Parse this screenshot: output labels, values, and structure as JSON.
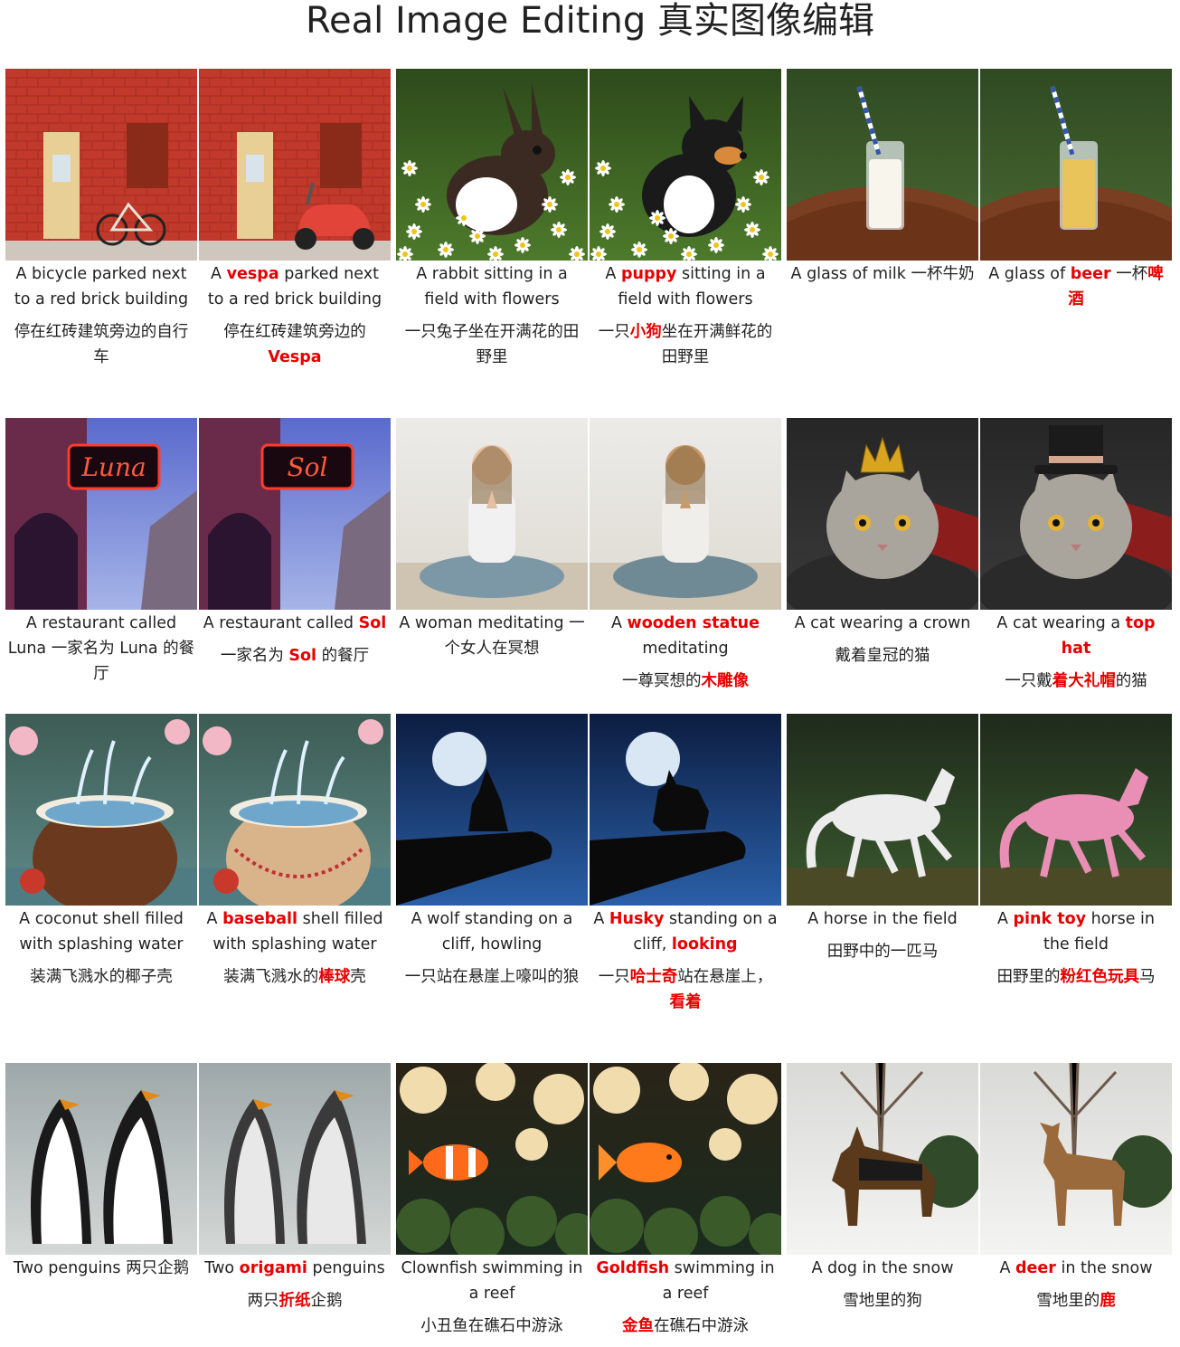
{
  "page": {
    "title": "Real Image Editing 真实图像编辑"
  },
  "colors": {
    "highlight": "#e60000",
    "text": "#222222"
  },
  "rows": [
    {
      "cells": [
        {
          "image": "bicycle-red-brick-wall",
          "en": [
            {
              "t": "A bicycle parked next to a red brick building"
            }
          ],
          "zh": [
            {
              "t": "停在红砖建筑旁边的自行车"
            }
          ]
        },
        {
          "image": "vespa-red-brick-wall",
          "en": [
            {
              "t": "A "
            },
            {
              "t": "vespa",
              "h": true
            },
            {
              "t": " parked next to a red brick building"
            }
          ],
          "zh": [
            {
              "t": "停在红砖建筑旁边的"
            },
            {
              "t": "Vespa",
              "h": true
            }
          ]
        },
        {
          "image": "rabbit-in-daisy-field",
          "en": [
            {
              "t": "A rabbit sitting in a field with flowers"
            }
          ],
          "zh": [
            {
              "t": "一只兔子坐在开满花的田野里"
            }
          ]
        },
        {
          "image": "puppy-in-daisy-field",
          "en": [
            {
              "t": "A "
            },
            {
              "t": "puppy",
              "h": true
            },
            {
              "t": " sitting in a field with flowers"
            }
          ],
          "zh": [
            {
              "t": "一只"
            },
            {
              "t": "小狗",
              "h": true
            },
            {
              "t": "坐在开满鲜花的田野里"
            }
          ]
        },
        {
          "image": "glass-of-milk",
          "en": [
            {
              "t": "A glass of milk 一杯牛奶"
            }
          ],
          "zh": []
        },
        {
          "image": "glass-of-beer",
          "en": [
            {
              "t": "A glass of "
            },
            {
              "t": "beer",
              "h": true
            },
            {
              "t": " 一杯"
            },
            {
              "t": "啤酒",
              "h": true
            }
          ],
          "zh": []
        }
      ]
    },
    {
      "cells": [
        {
          "image": "neon-sign-luna",
          "en": [
            {
              "t": "A restaurant called Luna 一家名为 Luna 的餐厅"
            }
          ],
          "zh": []
        },
        {
          "image": "neon-sign-sol",
          "en": [
            {
              "t": "A restaurant called "
            },
            {
              "t": "Sol",
              "h": true
            }
          ],
          "zh": [
            {
              "t": "一家名为 "
            },
            {
              "t": "Sol",
              "h": true
            },
            {
              "t": " 的餐厅"
            }
          ]
        },
        {
          "image": "woman-meditating",
          "en": [
            {
              "t": "A woman meditating 一个女人在冥想"
            }
          ],
          "zh": []
        },
        {
          "image": "wooden-statue-meditating",
          "en": [
            {
              "t": "A "
            },
            {
              "t": "wooden statue",
              "h": true
            },
            {
              "t": " meditating"
            }
          ],
          "zh": [
            {
              "t": "一尊冥想的"
            },
            {
              "t": "木雕像",
              "h": true
            }
          ]
        },
        {
          "image": "cat-with-crown",
          "en": [
            {
              "t": "A cat wearing a crown"
            }
          ],
          "zh": [
            {
              "t": "戴着皇冠的猫"
            }
          ]
        },
        {
          "image": "cat-with-top-hat",
          "en": [
            {
              "t": "A cat wearing a "
            },
            {
              "t": "top hat",
              "h": true
            }
          ],
          "zh": [
            {
              "t": "一只戴"
            },
            {
              "t": "着大礼帽",
              "h": true
            },
            {
              "t": "的猫"
            }
          ]
        }
      ]
    },
    {
      "cells": [
        {
          "image": "coconut-splash",
          "en": [
            {
              "t": "A coconut shell filled with splashing water"
            }
          ],
          "zh": [
            {
              "t": "装满飞溅水的椰子壳"
            }
          ]
        },
        {
          "image": "baseball-splash",
          "en": [
            {
              "t": "A "
            },
            {
              "t": "baseball",
              "h": true
            },
            {
              "t": " shell filled with splashing water"
            }
          ],
          "zh": [
            {
              "t": "装满飞溅水的"
            },
            {
              "t": "棒球",
              "h": true
            },
            {
              "t": "壳"
            }
          ]
        },
        {
          "image": "wolf-howling-moon",
          "en": [
            {
              "t": "A wolf standing on a cliff, howling"
            }
          ],
          "zh": [
            {
              "t": "一只站在悬崖上嚎叫的狼"
            }
          ]
        },
        {
          "image": "husky-on-cliff",
          "en": [
            {
              "t": "A "
            },
            {
              "t": "Husky",
              "h": true
            },
            {
              "t": " standing on a cliff, "
            },
            {
              "t": "looking",
              "h": true
            }
          ],
          "zh": [
            {
              "t": "一只"
            },
            {
              "t": "哈士奇",
              "h": true
            },
            {
              "t": "站在悬崖上，"
            },
            {
              "t": "看着",
              "h": true
            }
          ]
        },
        {
          "image": "white-horse-running",
          "en": [
            {
              "t": "A horse in the field"
            }
          ],
          "zh": [
            {
              "t": "田野中的一匹马"
            }
          ]
        },
        {
          "image": "pink-toy-horse",
          "en": [
            {
              "t": "A "
            },
            {
              "t": "pink toy",
              "h": true
            },
            {
              "t": " horse in the field"
            }
          ],
          "zh": [
            {
              "t": "田野里的"
            },
            {
              "t": "粉红色玩具",
              "h": true
            },
            {
              "t": "马"
            }
          ]
        }
      ]
    },
    {
      "cells": [
        {
          "image": "two-penguins",
          "en": [
            {
              "t": "Two penguins 两只企鹅"
            }
          ],
          "zh": []
        },
        {
          "image": "two-origami-penguins",
          "en": [
            {
              "t": "Two "
            },
            {
              "t": "origami",
              "h": true
            },
            {
              "t": " penguins"
            }
          ],
          "zh": [
            {
              "t": "两只"
            },
            {
              "t": "折纸",
              "h": true
            },
            {
              "t": "企鹅"
            }
          ]
        },
        {
          "image": "clownfish-reef",
          "en": [
            {
              "t": "Clownfish swimming in a reef"
            }
          ],
          "zh": [
            {
              "t": "小丑鱼在礁石中游泳"
            }
          ]
        },
        {
          "image": "goldfish-reef",
          "en": [
            {
              "t": "Goldfish",
              "h": true
            },
            {
              "t": " swimming in a reef"
            }
          ],
          "zh": [
            {
              "t": "金鱼",
              "h": true
            },
            {
              "t": "在礁石中游泳"
            }
          ]
        },
        {
          "image": "dog-in-snow",
          "en": [
            {
              "t": "A dog in the snow"
            }
          ],
          "zh": [
            {
              "t": "雪地里的狗"
            }
          ]
        },
        {
          "image": "deer-in-snow",
          "en": [
            {
              "t": "A "
            },
            {
              "t": "deer",
              "h": true
            },
            {
              "t": " in the snow"
            }
          ],
          "zh": [
            {
              "t": "雪地里的"
            },
            {
              "t": "鹿",
              "h": true
            }
          ]
        }
      ]
    }
  ]
}
